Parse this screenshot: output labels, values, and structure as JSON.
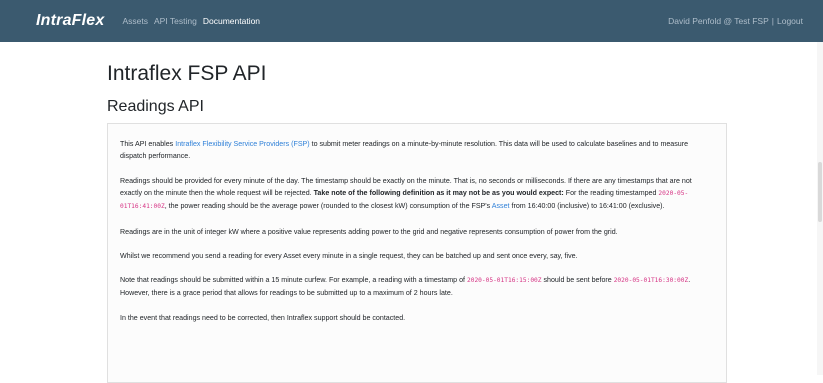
{
  "nav": {
    "brand": "IntraFlex",
    "links": [
      "Assets",
      "API Testing",
      "Documentation"
    ],
    "user": "David Penfold @ Test FSP",
    "separator": "|",
    "logout": "Logout"
  },
  "page": {
    "title": "Intraflex FSP API",
    "section": "Readings API"
  },
  "content": {
    "p1": {
      "pre": "This API enables ",
      "link": "Intraflex Flexibility Service Providers (FSP)",
      "post": " to submit meter readings on a minute-by-minute resolution. This data will be used to calculate baselines and to measure dispatch performance."
    },
    "p2": {
      "a": "Readings should be provided for every minute of the day. The timestamp should be exactly on the minute. That is, no seconds or milliseconds. If there are any timestamps that are not exactly on the minute then the whole request will be rejected. ",
      "bold": "Take note of the following definition as it may not be as you would expect:",
      "b": " For the reading timestamped ",
      "code": "2020-05-01T16:41:00Z",
      "c": ", the power reading should be the average power (rounded to the closest kW) consumption of the FSP's ",
      "link": "Asset",
      "d": " from 16:40:00 (inclusive) to 16:41:00 (exclusive)."
    },
    "p3": "Readings are in the unit of integer kW where a positive value represents adding power to the grid and negative represents consumption of power from the grid.",
    "p4": "Whilst we recommend you send a reading for every Asset every minute in a single request, they can be batched up and sent once every, say, five.",
    "p5": {
      "a": "Note that readings should be submitted within a 15 minute curfew. For example, a reading with a timestamp of ",
      "code1": "2020-05-01T16:15:00Z",
      "b": " should be sent before ",
      "code2": "2020-05-01T16:30:00Z",
      "c": ". However, there is a grace period that allows for readings to be submitted up to a maximum of 2 hours late."
    },
    "p6": "In the event that readings need to be corrected, then Intraflex support should be contacted."
  },
  "colors": {
    "navbar": "#3b5a6f",
    "link": "#2f80d8",
    "code": "#d63384"
  }
}
